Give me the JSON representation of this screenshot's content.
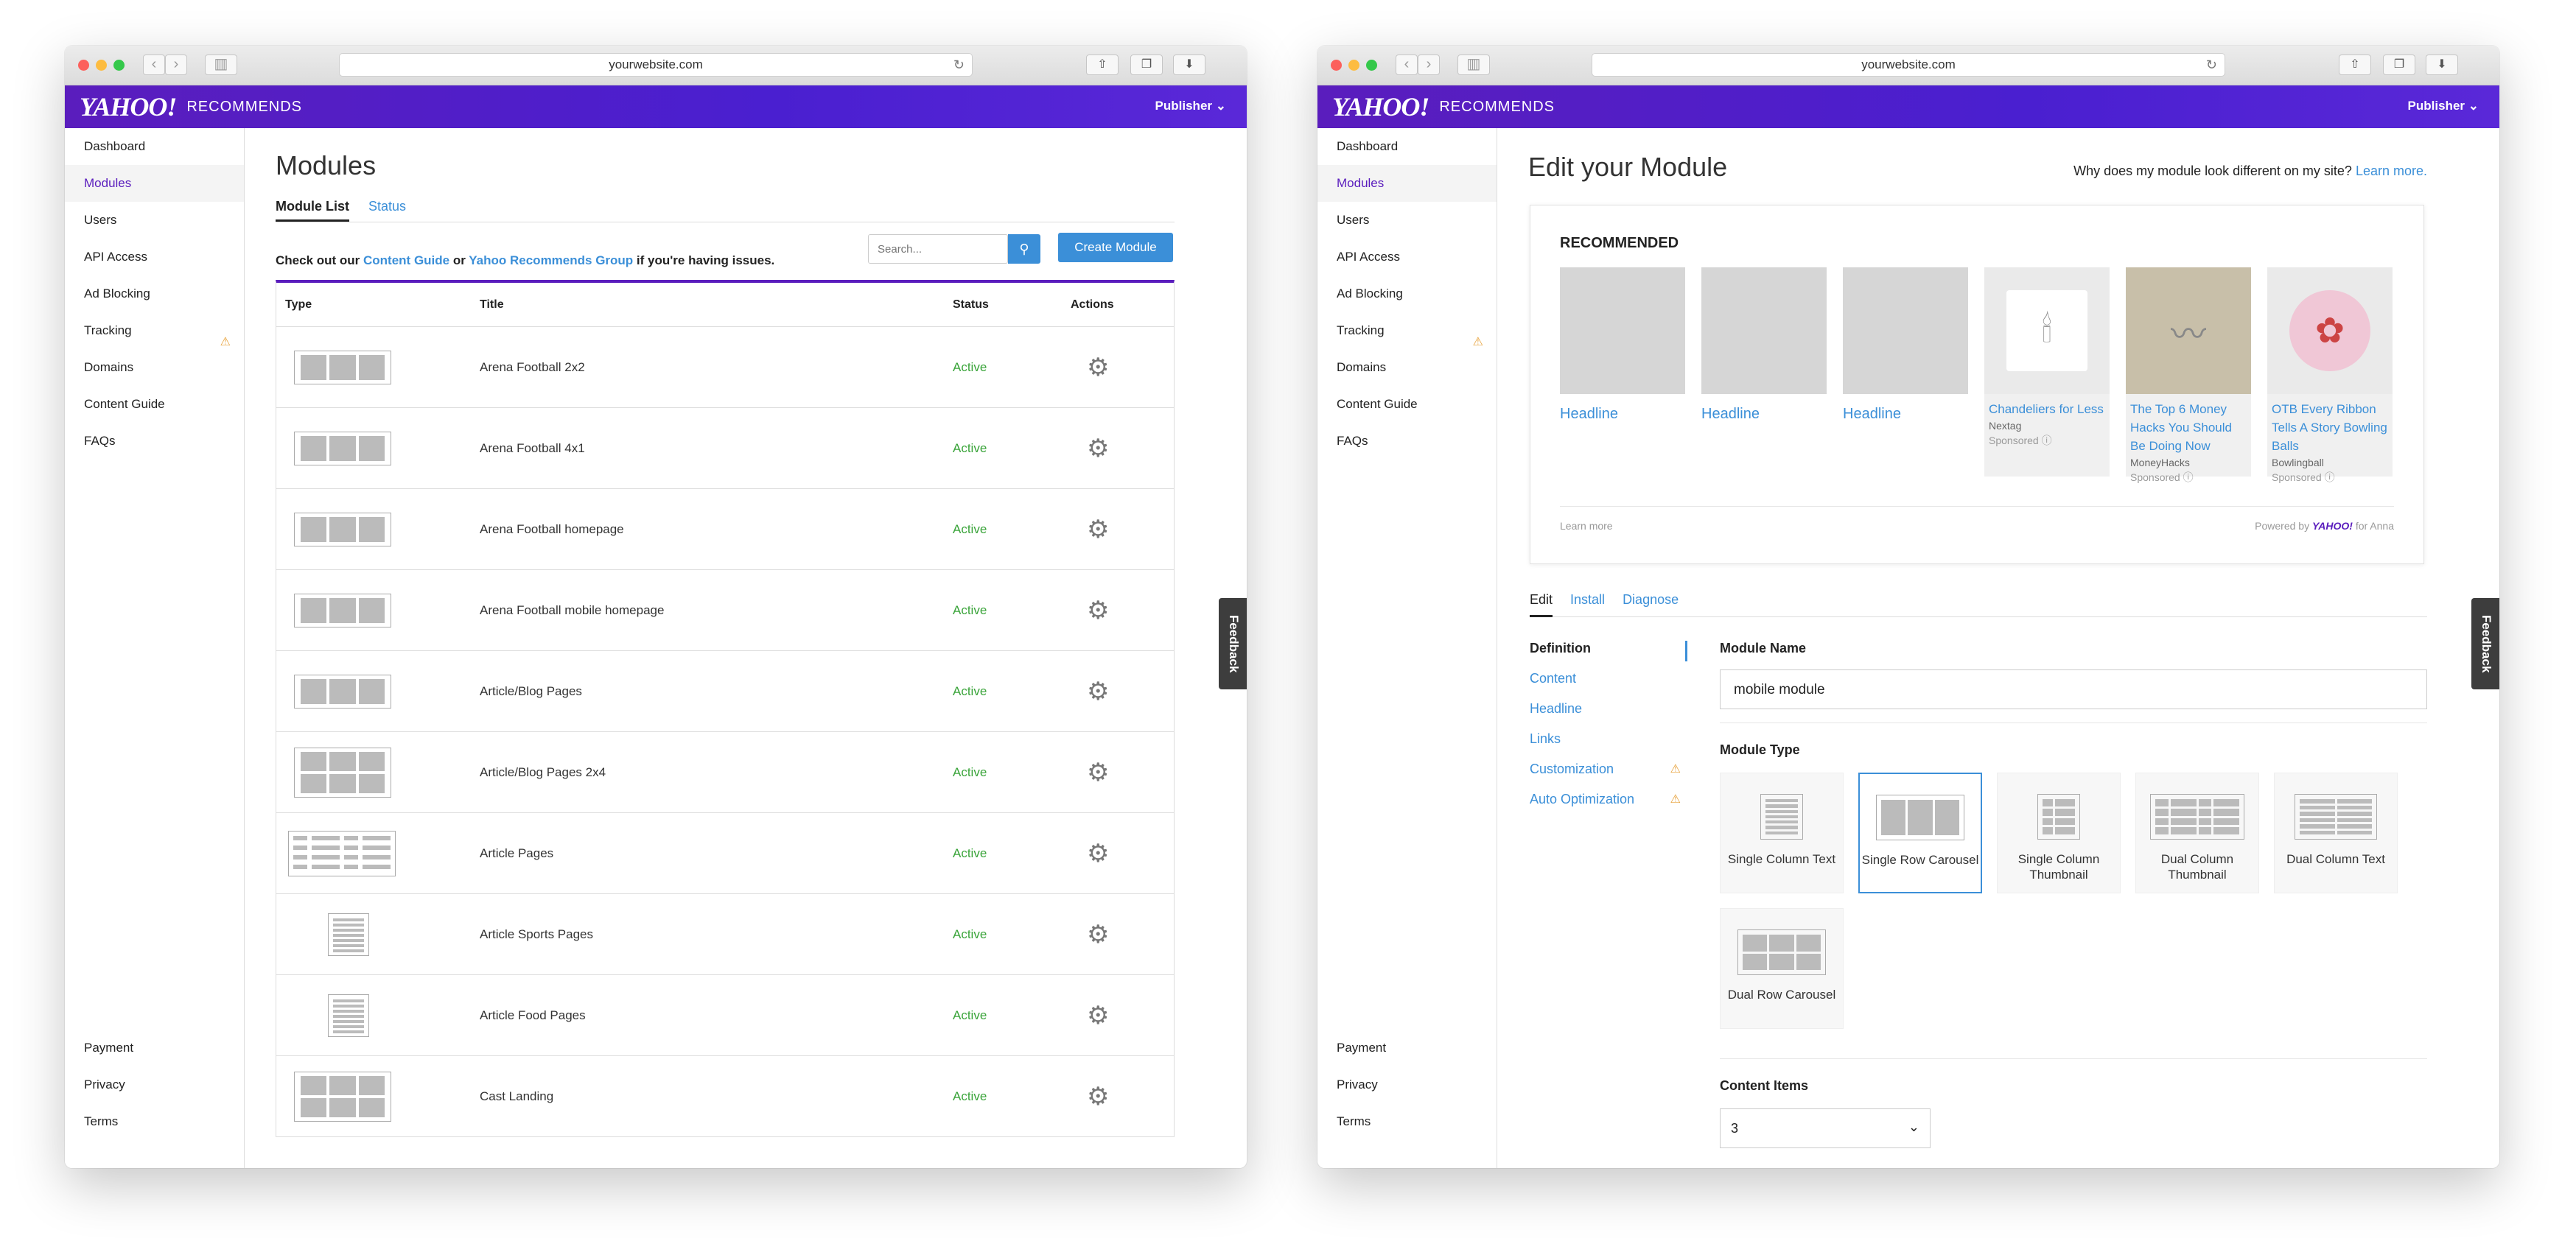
{
  "browser": {
    "url": "yourwebsite.com",
    "back_glyph": "‹",
    "forward_glyph": "›",
    "reload_glyph": "↻",
    "share_glyph": "⇧",
    "tabs_glyph": "❐",
    "download_glyph": "⬇",
    "sidebar_glyph": "▥"
  },
  "brand": {
    "logo": "Yahoo!",
    "product": "Recommends",
    "publisher": "Publisher",
    "chevron": "⌄",
    "accent": "#5a1dbd",
    "link": "#3b8fd8",
    "status_green": "#3aa43a"
  },
  "sidebar": {
    "items": [
      "Dashboard",
      "Modules",
      "Users",
      "API Access",
      "Ad Blocking",
      "Tracking",
      "Domains",
      "Content Guide",
      "FAQs"
    ],
    "bottom": [
      "Payment",
      "Privacy",
      "Terms"
    ],
    "tracking_badge": "⚠"
  },
  "feedback": "Feedback",
  "modules_page": {
    "title": "Modules",
    "tabs": [
      "Module List",
      "Status"
    ],
    "tip_prefix": "Check out our ",
    "tip_link1": "Content Guide",
    "tip_mid": " or ",
    "tip_link2": "Yahoo Recommends Group",
    "tip_suffix": " if you're having issues.",
    "search_placeholder": "Search...",
    "search_icon": "🔍",
    "create_label": "Create Module",
    "columns": [
      "Type",
      "Title",
      "Status",
      "Actions"
    ],
    "gear_glyph": "⚙",
    "rows": [
      {
        "title": "Arena Football 2x2",
        "status": "Active",
        "icon": "row"
      },
      {
        "title": "Arena Football 4x1",
        "status": "Active",
        "icon": "row"
      },
      {
        "title": "Arena Football homepage",
        "status": "Active",
        "icon": "row"
      },
      {
        "title": "Arena Football mobile homepage",
        "status": "Active",
        "icon": "row"
      },
      {
        "title": "Article/Blog Pages",
        "status": "Active",
        "icon": "row"
      },
      {
        "title": "Article/Blog Pages 2x4",
        "status": "Active",
        "icon": "grid2"
      },
      {
        "title": "Article Pages",
        "status": "Active",
        "icon": "wide"
      },
      {
        "title": "Article Sports Pages",
        "status": "Active",
        "icon": "col"
      },
      {
        "title": "Article Food Pages",
        "status": "Active",
        "icon": "col"
      },
      {
        "title": "Cast Landing",
        "status": "Active",
        "icon": "grid2"
      }
    ]
  },
  "edit_page": {
    "title": "Edit your Module",
    "why_text": "Why does my module look different on my site? ",
    "why_link": "Learn more.",
    "preview": {
      "heading": "RECOMMENDED",
      "headlines": [
        "Headline",
        "Headline",
        "Headline"
      ],
      "sponsored": [
        {
          "title": "Chandeliers for Less",
          "source": "Nextag",
          "label": "Sponsored ⓘ",
          "icon": "chandelier-icon",
          "glyph": "🕯"
        },
        {
          "title": "The Top 6 Money Hacks You Should Be Doing Now",
          "source": "MoneyHacks",
          "label": "Sponsored ⓘ",
          "icon": "hair-image",
          "glyph": "〰"
        },
        {
          "title": "OTB Every Ribbon Tells A Story Bowling Balls",
          "source": "Bowlingball",
          "label": "Sponsored ⓘ",
          "icon": "bowling-ball-image",
          "glyph": "✿"
        }
      ],
      "learn_more": "Learn more",
      "powered_prefix": "Powered by ",
      "powered_brand": "YAHOO!",
      "powered_suffix": " for Anna"
    },
    "tabs": [
      "Edit",
      "Install",
      "Diagnose"
    ],
    "def_nav": [
      "Definition",
      "Content",
      "Headline",
      "Links",
      "Customization",
      "Auto Optimization"
    ],
    "module_name_label": "Module Name",
    "module_name_value": "mobile module",
    "module_type_label": "Module Type",
    "types": [
      {
        "label": "Single Column Text",
        "icon": "col"
      },
      {
        "label": "Single Row Carousel",
        "icon": "row3",
        "selected": true
      },
      {
        "label": "Single Column Thumbnail",
        "icon": "thumb1"
      },
      {
        "label": "Dual Column Thumbnail",
        "icon": "dual"
      },
      {
        "label": "Dual Column Text",
        "icon": "dualt"
      },
      {
        "label": "Dual Row Carousel",
        "icon": "grid2"
      }
    ],
    "content_items_label": "Content Items",
    "content_items_value": "3"
  }
}
